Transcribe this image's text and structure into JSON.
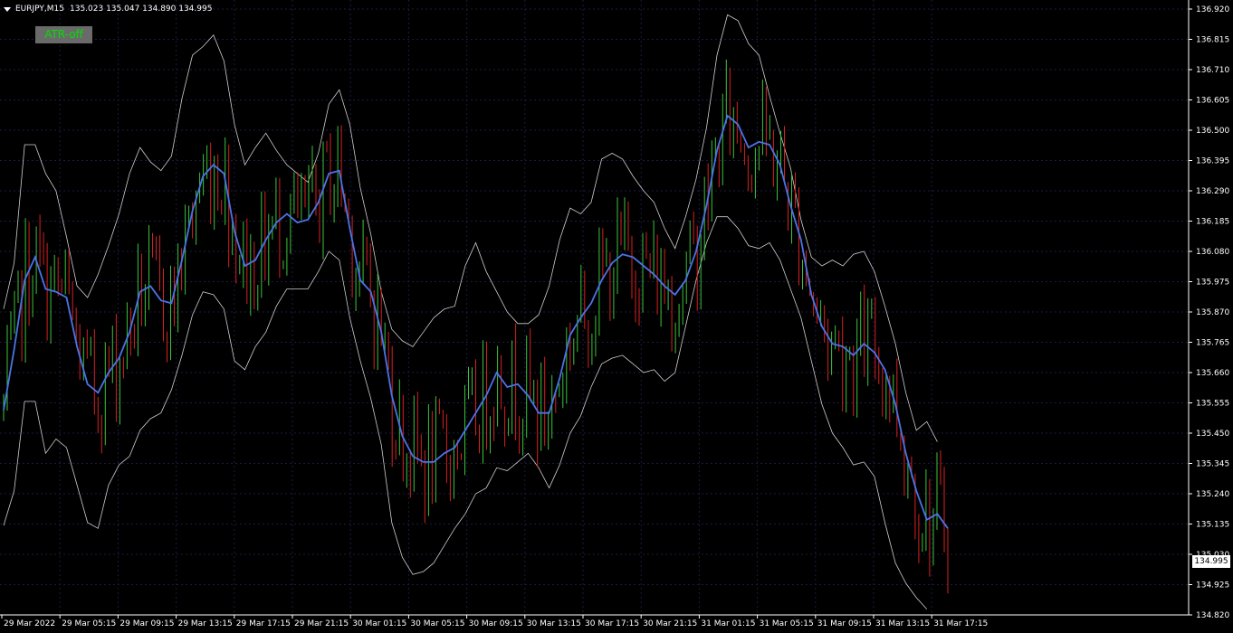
{
  "header": {
    "symbol": "EURJPY,M15",
    "ohlc": "135.023 135.047 134.890 134.995"
  },
  "button": {
    "label": "ATR-off"
  },
  "last_price": "134.995",
  "colors": {
    "background": "#000000",
    "grid": "#1b1b44",
    "axis": "#ffffff",
    "bull": "#3ac43a",
    "bear": "#d82020",
    "ma": "#4a74e8",
    "bands": "#cfcfcf",
    "button_bg": "#6a6a6a",
    "button_text": "#00e000"
  },
  "chart_data": {
    "type": "line",
    "symbol": "EURJPY",
    "timeframe": "M15",
    "ylim": [
      134.82,
      136.925
    ],
    "y_ticks": [
      "136.920",
      "136.815",
      "136.710",
      "136.605",
      "136.500",
      "136.395",
      "136.290",
      "136.185",
      "136.080",
      "135.975",
      "135.870",
      "135.765",
      "135.660",
      "135.555",
      "135.450",
      "135.345",
      "135.240",
      "135.135",
      "135.030",
      "134.925",
      "134.820"
    ],
    "x_ticks": [
      "29 Mar 2022",
      "29 Mar 05:15",
      "29 Mar 09:15",
      "29 Mar 13:15",
      "29 Mar 17:15",
      "29 Mar 21:15",
      "30 Mar 01:15",
      "30 Mar 05:15",
      "30 Mar 09:15",
      "30 Mar 13:15",
      "30 Mar 17:15",
      "30 Mar 21:15",
      "31 Mar 01:15",
      "31 Mar 05:15",
      "31 Mar 09:15",
      "31 Mar 13:15",
      "31 Mar 17:15"
    ],
    "bar_count": 261,
    "grid": true,
    "series": [
      {
        "name": "MA",
        "values": [
          135.53,
          135.74,
          135.98,
          136.06,
          135.95,
          135.94,
          135.92,
          135.75,
          135.62,
          135.59,
          135.66,
          135.71,
          135.8,
          135.94,
          135.96,
          135.91,
          135.9,
          136.05,
          136.22,
          136.34,
          136.38,
          136.35,
          136.15,
          136.03,
          136.05,
          136.12,
          136.18,
          136.21,
          136.18,
          136.19,
          136.25,
          136.35,
          136.36,
          136.16,
          135.98,
          135.94,
          135.8,
          135.58,
          135.44,
          135.37,
          135.35,
          135.35,
          135.38,
          135.4,
          135.46,
          135.52,
          135.58,
          135.66,
          135.61,
          135.62,
          135.58,
          135.52,
          135.52,
          135.64,
          135.79,
          135.85,
          135.9,
          135.98,
          136.04,
          136.07,
          136.06,
          136.03,
          136.0,
          135.96,
          135.93,
          135.98,
          136.08,
          136.24,
          136.43,
          136.55,
          136.52,
          136.44,
          136.46,
          136.45,
          136.38,
          136.24,
          136.12,
          135.93,
          135.82,
          135.76,
          135.75,
          135.72,
          135.76,
          135.73,
          135.67,
          135.55,
          135.38,
          135.25,
          135.15,
          135.17,
          135.12
        ]
      },
      {
        "name": "Upper",
        "values": [
          135.88,
          136.04,
          136.45,
          136.45,
          136.35,
          136.29,
          136.13,
          135.96,
          135.92,
          136.0,
          136.1,
          136.21,
          136.35,
          136.44,
          136.39,
          136.36,
          136.41,
          136.61,
          136.76,
          136.79,
          136.83,
          136.74,
          136.52,
          136.38,
          136.44,
          136.49,
          136.43,
          136.38,
          136.35,
          136.32,
          136.42,
          136.59,
          136.64,
          136.52,
          136.3,
          136.14,
          135.94,
          135.81,
          135.77,
          135.75,
          135.8,
          135.85,
          135.88,
          135.89,
          136.03,
          136.11,
          136.01,
          135.94,
          135.87,
          135.83,
          135.83,
          135.86,
          135.96,
          136.12,
          136.23,
          136.21,
          136.25,
          136.4,
          136.42,
          136.4,
          136.34,
          136.29,
          136.25,
          136.16,
          136.09,
          136.2,
          136.33,
          136.51,
          136.76,
          136.9,
          136.88,
          136.8,
          136.76,
          136.62,
          136.49,
          136.37,
          136.19,
          136.06,
          136.03,
          136.05,
          136.03,
          136.07,
          136.08,
          136.01,
          135.89,
          135.76,
          135.59,
          135.46,
          135.49,
          135.42
        ]
      },
      {
        "name": "Lower",
        "values": [
          135.13,
          135.25,
          135.56,
          135.56,
          135.38,
          135.43,
          135.4,
          135.27,
          135.14,
          135.12,
          135.27,
          135.34,
          135.37,
          135.46,
          135.5,
          135.52,
          135.6,
          135.72,
          135.86,
          135.94,
          135.93,
          135.88,
          135.7,
          135.67,
          135.75,
          135.8,
          135.89,
          135.95,
          135.95,
          135.95,
          136.01,
          136.08,
          136.05,
          135.85,
          135.7,
          135.57,
          135.41,
          135.14,
          135.02,
          134.96,
          134.97,
          135.0,
          135.06,
          135.12,
          135.17,
          135.24,
          135.26,
          135.33,
          135.32,
          135.35,
          135.38,
          135.33,
          135.26,
          135.34,
          135.45,
          135.51,
          135.61,
          135.69,
          135.71,
          135.72,
          135.69,
          135.66,
          135.67,
          135.63,
          135.66,
          135.82,
          135.98,
          136.11,
          136.2,
          136.2,
          136.16,
          136.1,
          136.09,
          136.11,
          136.05,
          135.95,
          135.85,
          135.7,
          135.55,
          135.45,
          135.4,
          135.34,
          135.35,
          135.3,
          135.14,
          135.0,
          134.93,
          134.88,
          134.84
        ]
      }
    ]
  }
}
